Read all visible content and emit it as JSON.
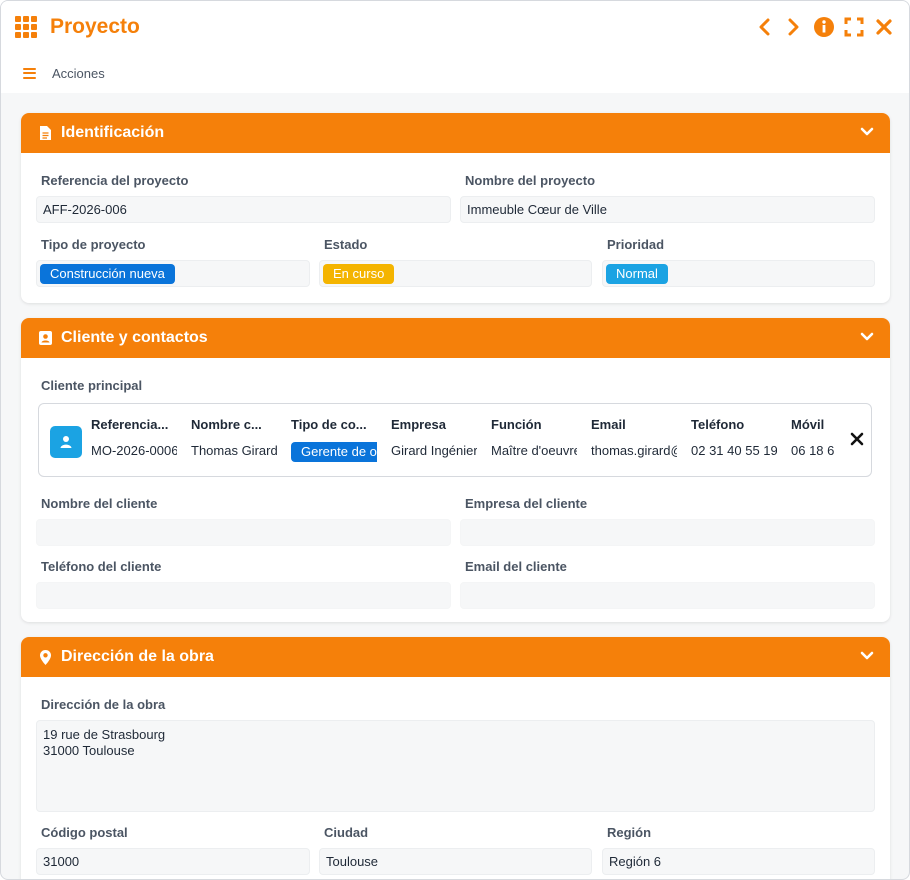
{
  "window": {
    "title": "Proyecto"
  },
  "actionbar": {
    "label": "Acciones"
  },
  "colors": {
    "accent": "#f5800a",
    "tag_blue": "#0a74da",
    "tag_yellow": "#f4b400",
    "tag_cyan": "#1ba3e3"
  },
  "identificacion": {
    "title": "Identificación",
    "referencia": {
      "label": "Referencia del proyecto",
      "value": "AFF-2026-006"
    },
    "nombre": {
      "label": "Nombre del proyecto",
      "value": "Immeuble Cœur de Ville"
    },
    "tipo": {
      "label": "Tipo de proyecto",
      "value": "Construcción nueva"
    },
    "estado": {
      "label": "Estado",
      "value": "En curso"
    },
    "prioridad": {
      "label": "Prioridad",
      "value": "Normal"
    }
  },
  "cliente": {
    "title": "Cliente y contactos",
    "principal_label": "Cliente principal",
    "columns": [
      "Referencia...",
      "Nombre c...",
      "Tipo de co...",
      "Empresa",
      "Función",
      "Email",
      "Teléfono",
      "Móvil"
    ],
    "row": {
      "referencia": "MO-2026-0006",
      "nombre": "Thomas Girard",
      "tipo": "Gerente de obra",
      "empresa": "Girard Ingénierie",
      "funcion": "Maître d'oeuvre",
      "email": "thomas.girard@",
      "telefono": "02 31 40 55 19",
      "movil": "06 18 6"
    },
    "nombre_cliente": {
      "label": "Nombre del cliente",
      "value": ""
    },
    "empresa_cliente": {
      "label": "Empresa del cliente",
      "value": ""
    },
    "telefono_cliente": {
      "label": "Teléfono del cliente",
      "value": ""
    },
    "email_cliente": {
      "label": "Email del cliente",
      "value": ""
    }
  },
  "direccion": {
    "title": "Dirección de la obra",
    "direccion": {
      "label": "Dirección de la obra",
      "value": "19 rue de Strasbourg\n31000 Toulouse"
    },
    "codigo_postal": {
      "label": "Código postal",
      "value": "31000"
    },
    "ciudad": {
      "label": "Ciudad",
      "value": "Toulouse"
    },
    "region": {
      "label": "Región",
      "value": "Región 6"
    }
  }
}
